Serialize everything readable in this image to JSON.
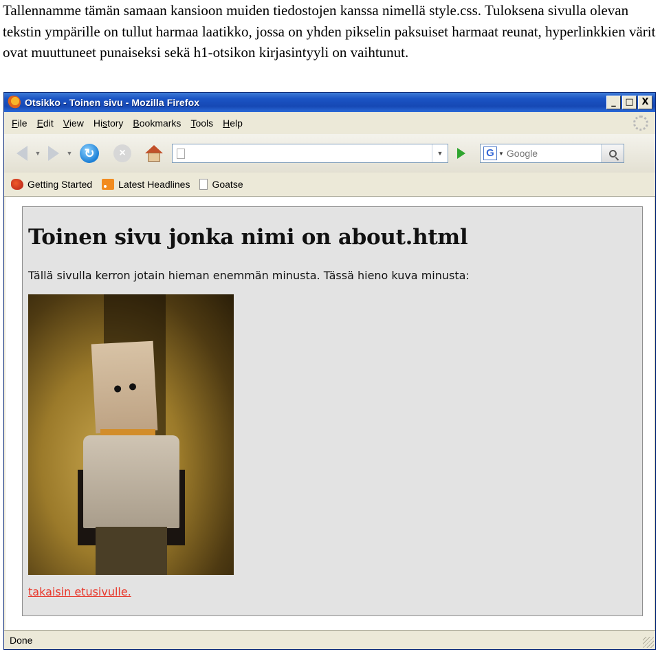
{
  "caption": {
    "text": "Tallennamme tämän samaan kansioon muiden tiedostojen kanssa nimellä style.css. Tuloksena sivulla olevan tekstin ympärille on tullut harmaa laatikko, jossa on yhden pikselin paksuiset harmaat reunat, hyperlinkkien värit ovat muuttuneet punaiseksi sekä h1-otsikon kirjasintyyli on vaihtunut."
  },
  "window": {
    "title": "Otsikko - Toinen sivu - Mozilla Firefox",
    "controls": {
      "minimize": "_",
      "maximize": "□",
      "close": "X"
    }
  },
  "menu": {
    "items": [
      {
        "accel": "F",
        "rest": "ile"
      },
      {
        "accel": "E",
        "rest": "dit"
      },
      {
        "accel": "V",
        "rest": "iew"
      },
      {
        "pre": "Hi",
        "accel": "s",
        "rest": "tory"
      },
      {
        "accel": "B",
        "rest": "ookmarks"
      },
      {
        "accel": "T",
        "rest": "ools"
      },
      {
        "accel": "H",
        "rest": "elp"
      }
    ]
  },
  "navigation": {
    "back_icon": "back-arrow-icon",
    "forward_icon": "forward-arrow-icon",
    "reload_icon": "reload-icon",
    "stop_icon": "stop-icon",
    "home_icon": "home-icon",
    "url": "",
    "search_placeholder": "Google",
    "search_engine_letter": "G"
  },
  "bookmarks": {
    "items": [
      {
        "label": "Getting Started",
        "icon": "firefox-icon"
      },
      {
        "label": "Latest Headlines",
        "icon": "rss-icon"
      },
      {
        "label": "Goatse",
        "icon": "page-icon"
      }
    ]
  },
  "page": {
    "heading": "Toinen sivu jonka nimi on about.html",
    "intro": "Tällä sivulla kerron jotain hieman enemmän minusta. Tässä hieno kuva minusta:",
    "link_text": "takaisin etusivulle."
  },
  "status": {
    "text": "Done"
  },
  "colors": {
    "link": "#e8382c",
    "box_background": "#e3e3e3",
    "box_border": "#8e8e8e",
    "titlebar": "#1648b4"
  }
}
